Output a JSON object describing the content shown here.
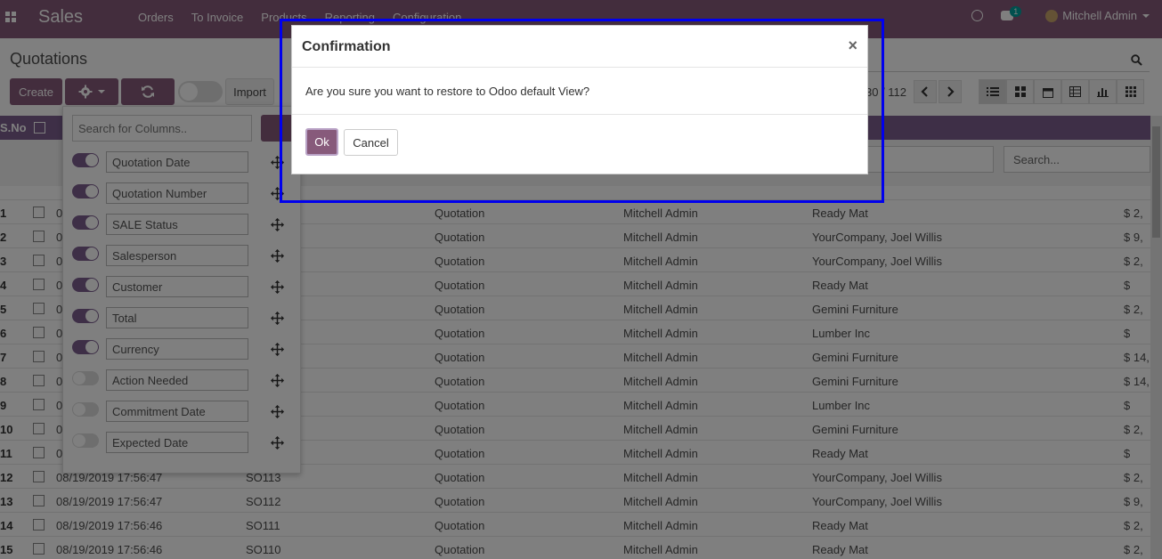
{
  "nav": {
    "brand": "Sales",
    "menu": [
      "Orders",
      "To Invoice",
      "Products",
      "Reporting",
      "Configuration"
    ],
    "chat_count": "1",
    "user": "Mitchell Admin"
  },
  "control": {
    "breadcrumb": "Quotations",
    "create_label": "Create",
    "import_label": "Import",
    "pager": "30 / 112"
  },
  "table": {
    "sno_header": "S.No",
    "filter_placeholder": "Search...",
    "rows": [
      {
        "n": "1",
        "date": "08",
        "ref": "",
        "status": "Quotation",
        "sales": "Mitchell Admin",
        "cust": "Ready Mat",
        "total": "$ 2,"
      },
      {
        "n": "2",
        "date": "08",
        "ref": "",
        "status": "Quotation",
        "sales": "Mitchell Admin",
        "cust": "YourCompany, Joel Willis",
        "total": "$ 9,"
      },
      {
        "n": "3",
        "date": "08",
        "ref": "",
        "status": "Quotation",
        "sales": "Mitchell Admin",
        "cust": "YourCompany, Joel Willis",
        "total": "$ 2,"
      },
      {
        "n": "4",
        "date": "08",
        "ref": "",
        "status": "Quotation",
        "sales": "Mitchell Admin",
        "cust": "Ready Mat",
        "total": "$"
      },
      {
        "n": "5",
        "date": "08",
        "ref": "",
        "status": "Quotation",
        "sales": "Mitchell Admin",
        "cust": "Gemini Furniture",
        "total": "$ 2,"
      },
      {
        "n": "6",
        "date": "08",
        "ref": "",
        "status": "Quotation",
        "sales": "Mitchell Admin",
        "cust": "Lumber Inc",
        "total": "$"
      },
      {
        "n": "7",
        "date": "08",
        "ref": "",
        "status": "Quotation",
        "sales": "Mitchell Admin",
        "cust": "Gemini Furniture",
        "total": "$ 14,"
      },
      {
        "n": "8",
        "date": "08",
        "ref": "",
        "status": "Quotation",
        "sales": "Mitchell Admin",
        "cust": "Gemini Furniture",
        "total": "$ 14,"
      },
      {
        "n": "9",
        "date": "08",
        "ref": "",
        "status": "Quotation",
        "sales": "Mitchell Admin",
        "cust": "Lumber Inc",
        "total": "$"
      },
      {
        "n": "10",
        "date": "08",
        "ref": "",
        "status": "Quotation",
        "sales": "Mitchell Admin",
        "cust": "Gemini Furniture",
        "total": "$ 2,"
      },
      {
        "n": "11",
        "date": "08",
        "ref": "",
        "status": "Quotation",
        "sales": "Mitchell Admin",
        "cust": "Ready Mat",
        "total": "$"
      },
      {
        "n": "12",
        "date": "08/19/2019 17:56:47",
        "ref": "SO113",
        "status": "Quotation",
        "sales": "Mitchell Admin",
        "cust": "YourCompany, Joel Willis",
        "total": "$ 2,"
      },
      {
        "n": "13",
        "date": "08/19/2019 17:56:47",
        "ref": "SO112",
        "status": "Quotation",
        "sales": "Mitchell Admin",
        "cust": "YourCompany, Joel Willis",
        "total": "$ 9,"
      },
      {
        "n": "14",
        "date": "08/19/2019 17:56:46",
        "ref": "SO111",
        "status": "Quotation",
        "sales": "Mitchell Admin",
        "cust": "Ready Mat",
        "total": "$ 2,"
      },
      {
        "n": "15",
        "date": "08/19/2019 17:56:46",
        "ref": "SO110",
        "status": "Quotation",
        "sales": "Mitchell Admin",
        "cust": "Ready Mat",
        "total": "$ 2,"
      }
    ]
  },
  "columns_panel": {
    "search_placeholder": "Search for Columns..",
    "items": [
      {
        "label": "Quotation Date",
        "on": true
      },
      {
        "label": "Quotation Number",
        "on": true
      },
      {
        "label": "SALE Status",
        "on": true
      },
      {
        "label": "Salesperson",
        "on": true
      },
      {
        "label": "Customer",
        "on": true
      },
      {
        "label": "Total",
        "on": true
      },
      {
        "label": "Currency",
        "on": true
      },
      {
        "label": "Action Needed",
        "on": false
      },
      {
        "label": "Commitment Date",
        "on": false
      },
      {
        "label": "Expected Date",
        "on": false
      }
    ]
  },
  "modal": {
    "title": "Confirmation",
    "close": "×",
    "message": "Are you sure you want to restore to Odoo default View?",
    "ok_label": "Ok",
    "cancel_label": "Cancel"
  },
  "colors": {
    "brand": "#875a7b",
    "highlight": "#0000ee"
  }
}
